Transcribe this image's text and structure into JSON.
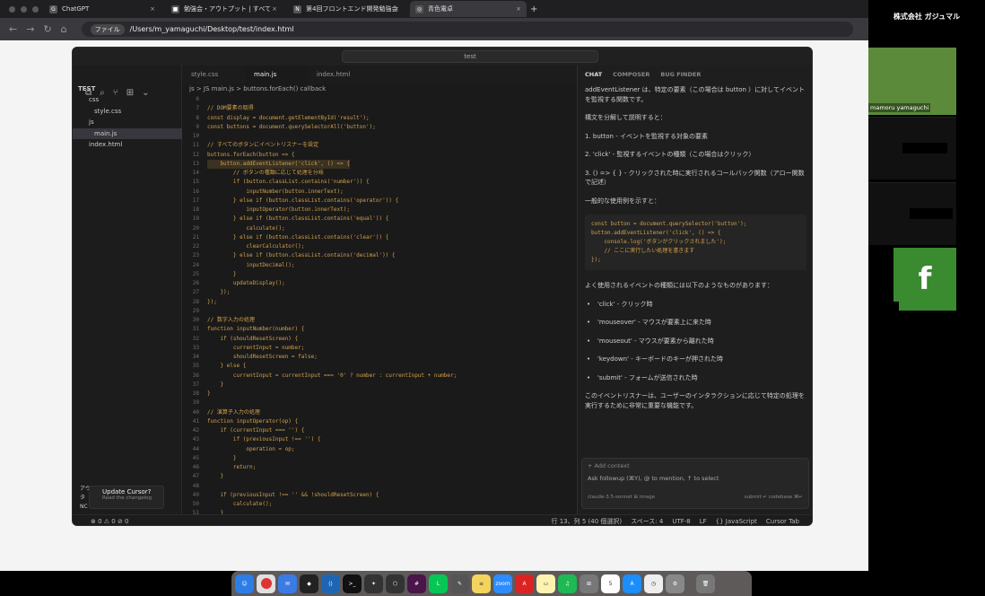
{
  "browser": {
    "tabs": [
      {
        "label": "ChatGPT",
        "fav": "G"
      },
      {
        "label": "勉強会・アウトプット | すべて",
        "fav": "■"
      },
      {
        "label": "第4回フロントエンド開発勉強会",
        "fav": "N"
      },
      {
        "label": "青色電卓",
        "fav": "◎"
      }
    ],
    "new_tab": "+",
    "url_badge": "ファイル",
    "url": "/Users/m_yamaguchi/Desktop/test/index.html"
  },
  "vscode": {
    "search": "test",
    "explorer": {
      "root": "TEST",
      "items": [
        "css",
        "style.css",
        "js",
        "main.js",
        "index.html"
      ],
      "bottom": [
        "アウトライン",
        "タ",
        "NC"
      ]
    },
    "toast": {
      "title": "Update Cursor?",
      "sub": "Read the changelog"
    },
    "tabs": [
      "style.css",
      "main.js",
      "index.html"
    ],
    "breadcrumb": "js  >  JS main.js  >  buttons.forEach() callback",
    "code_lines": [
      {
        "n": "6",
        "t": ""
      },
      {
        "n": "7",
        "t": "// DOM要素の取得"
      },
      {
        "n": "8",
        "t": "const display = document.getElementById('result');"
      },
      {
        "n": "9",
        "t": "const buttons = document.querySelectorAll('button');"
      },
      {
        "n": "10",
        "t": ""
      },
      {
        "n": "11",
        "t": "// すべてのボタンにイベントリスナーを設定"
      },
      {
        "n": "12",
        "t": "buttons.forEach(button => {"
      },
      {
        "n": "13",
        "t": "    button.addEventListener('click', () => {"
      },
      {
        "n": "14",
        "t": "        // ボタンの種類に応じて処理を分岐"
      },
      {
        "n": "15",
        "t": "        if (button.classList.contains('number')) {"
      },
      {
        "n": "16",
        "t": "            inputNumber(button.innerText);"
      },
      {
        "n": "17",
        "t": "        } else if (button.classList.contains('operator')) {"
      },
      {
        "n": "18",
        "t": "            inputOperator(button.innerText);"
      },
      {
        "n": "19",
        "t": "        } else if (button.classList.contains('equal')) {"
      },
      {
        "n": "20",
        "t": "            calculate();"
      },
      {
        "n": "21",
        "t": "        } else if (button.classList.contains('clear')) {"
      },
      {
        "n": "22",
        "t": "            clearCalculator();"
      },
      {
        "n": "23",
        "t": "        } else if (button.classList.contains('decimal')) {"
      },
      {
        "n": "24",
        "t": "            inputDecimal();"
      },
      {
        "n": "25",
        "t": "        }"
      },
      {
        "n": "26",
        "t": "        updateDisplay();"
      },
      {
        "n": "27",
        "t": "    });"
      },
      {
        "n": "28",
        "t": "});"
      },
      {
        "n": "29",
        "t": ""
      },
      {
        "n": "30",
        "t": "// 数字入力の処理"
      },
      {
        "n": "31",
        "t": "function inputNumber(number) {"
      },
      {
        "n": "32",
        "t": "    if (shouldResetScreen) {"
      },
      {
        "n": "33",
        "t": "        currentInput = number;"
      },
      {
        "n": "34",
        "t": "        shouldResetScreen = false;"
      },
      {
        "n": "35",
        "t": "    } else {"
      },
      {
        "n": "36",
        "t": "        currentInput = currentInput === '0' ? number : currentInput + number;"
      },
      {
        "n": "37",
        "t": "    }"
      },
      {
        "n": "38",
        "t": "}"
      },
      {
        "n": "39",
        "t": ""
      },
      {
        "n": "40",
        "t": "// 演算子入力の処理"
      },
      {
        "n": "41",
        "t": "function inputOperator(op) {"
      },
      {
        "n": "42",
        "t": "    if (currentInput === '') {"
      },
      {
        "n": "43",
        "t": "        if (previousInput !== '') {"
      },
      {
        "n": "44",
        "t": "            operation = op;"
      },
      {
        "n": "45",
        "t": "        }"
      },
      {
        "n": "46",
        "t": "        return;"
      },
      {
        "n": "47",
        "t": "    }"
      },
      {
        "n": "48",
        "t": ""
      },
      {
        "n": "49",
        "t": "    if (previousInput !== '' && !shouldResetScreen) {"
      },
      {
        "n": "50",
        "t": "        calculate();"
      },
      {
        "n": "51",
        "t": "    }"
      }
    ],
    "chat": {
      "tabs": [
        "CHAT",
        "COMPOSER",
        "BUG FINDER"
      ],
      "intro": "addEventListener は、特定の要素（この場合は button ）に対してイベントを監視する関数です。",
      "breakdown_title": "構文を分解して説明すると：",
      "points": [
        "1. button - イベントを監視する対象の要素",
        "2. 'click' - 監視するイベントの種類（この場合はクリック）",
        "3. () => { } - クリックされた時に実行されるコールバック関数（アロー関数で記述）"
      ],
      "example_title": "一般的な使用例を示すと：",
      "example_code": "const button = document.querySelector('button');\nbutton.addEventListener('click', () => {\n    console.log('ボタンがクリックされました');\n    // ここに実行したい処理を書きます\n});",
      "events_title": "よく使用されるイベントの種類には以下のようなものがあります：",
      "events": [
        "'click' - クリック時",
        "'mouseover' - マウスが要素上に来た時",
        "'mouseout' - マウスが要素から離れた時",
        "'keydown' - キーボードのキーが押された時",
        "'submit' - フォームが送信された時"
      ],
      "outro": "このイベントリスナーは、ユーザーのインタラクションに応じて特定の処理を実行するために非常に重要な機能です。",
      "add_context": "+ Add context",
      "placeholder": "Ask followup (⌘Y), @ to mention, ↑ to select",
      "model": "claude-3.5-sonnet  ⊞ image",
      "submit": "submit ↵",
      "codebase": "codebase ⌘↵"
    },
    "status": {
      "left": "⊗ 0 ⚠ 0  ⊘ 0",
      "position": "行 13、列 5 (40 個選択)",
      "spaces": "スペース: 4",
      "encoding": "UTF-8",
      "eol": "LF",
      "lang": "{} JavaScript",
      "tab": "Cursor Tab"
    }
  },
  "meeting": {
    "company": "株式会社 ガジュマル",
    "participant": "mamoru yamaguchi",
    "tile_letter": "f"
  },
  "dock": {
    "calendar_day": "5",
    "zoom": "zoom"
  }
}
